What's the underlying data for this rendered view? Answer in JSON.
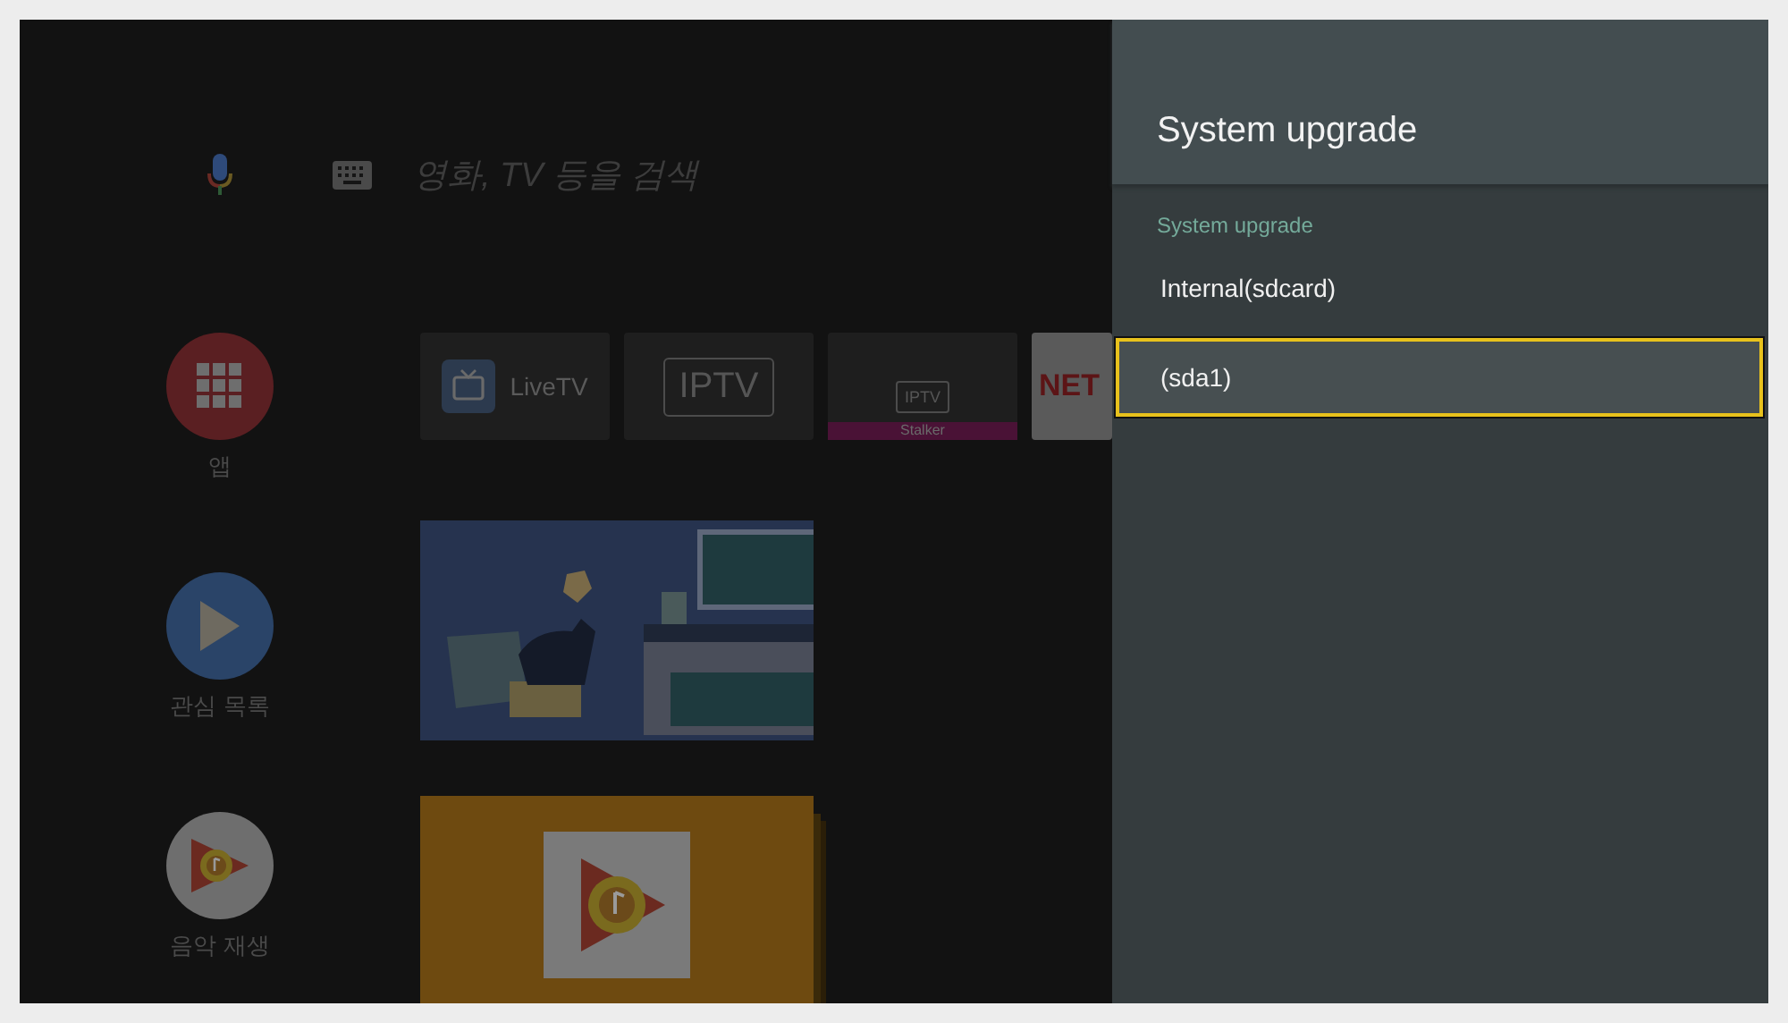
{
  "search": {
    "placeholder": "영화, TV 등을 검색"
  },
  "nav": [
    {
      "kind": "apps",
      "label": "앱"
    },
    {
      "kind": "watchlist",
      "label": "관심 목록"
    },
    {
      "kind": "music",
      "label": "음악 재생"
    }
  ],
  "app_tiles": [
    {
      "kind": "livetv",
      "label": "LiveTV"
    },
    {
      "kind": "iptv",
      "label": "IPTV"
    },
    {
      "kind": "stalker",
      "label": "IPTV",
      "badge": "Stalker"
    },
    {
      "kind": "netflix",
      "label": "NET"
    }
  ],
  "panel": {
    "title": "System upgrade",
    "section": "System upgrade",
    "options": [
      {
        "label": "Internal(sdcard)",
        "selected": false
      },
      {
        "label": "(sda1)",
        "selected": true
      }
    ]
  }
}
